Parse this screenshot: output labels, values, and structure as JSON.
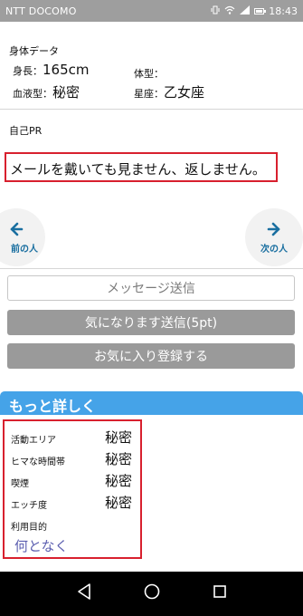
{
  "status_bar": {
    "carrier": "NTT DOCOMO",
    "time": "18:43",
    "icons": [
      "vibrate-icon",
      "wifi-icon",
      "signal-icon",
      "battery-icon"
    ]
  },
  "body_data": {
    "title": "身体データ",
    "height_label": "身長：",
    "height_value": "165cm",
    "body_type_label": "体型：",
    "body_type_value": "",
    "blood_label": "血液型：",
    "blood_value": "秘密",
    "sign_label": "星座：",
    "sign_value": "乙女座"
  },
  "self_pr": {
    "title": "自己PR",
    "text": "メールを戴いても見ません、返しません。"
  },
  "navigation": {
    "prev_label": "前の人",
    "next_label": "次の人"
  },
  "buttons": {
    "message": "メッセージ送信",
    "interest": "気になります送信(5pt)",
    "favorite": "お気に入り登録する"
  },
  "more_detail": {
    "header": "もっと詳しく",
    "rows": [
      {
        "label": "活動エリア",
        "value": "秘密"
      },
      {
        "label": "ヒマな時間帯",
        "value": "秘密"
      },
      {
        "label": "喫煙",
        "value": "秘密"
      },
      {
        "label": "エッチ度",
        "value": "秘密"
      }
    ],
    "purpose_label": "利用目的",
    "purpose_value": "何となく"
  },
  "colors": {
    "highlight_border": "#d8202e",
    "section_header": "#45a3e8",
    "link_blue": "#1a6fa0",
    "purpose_text": "#5c5fb0"
  }
}
